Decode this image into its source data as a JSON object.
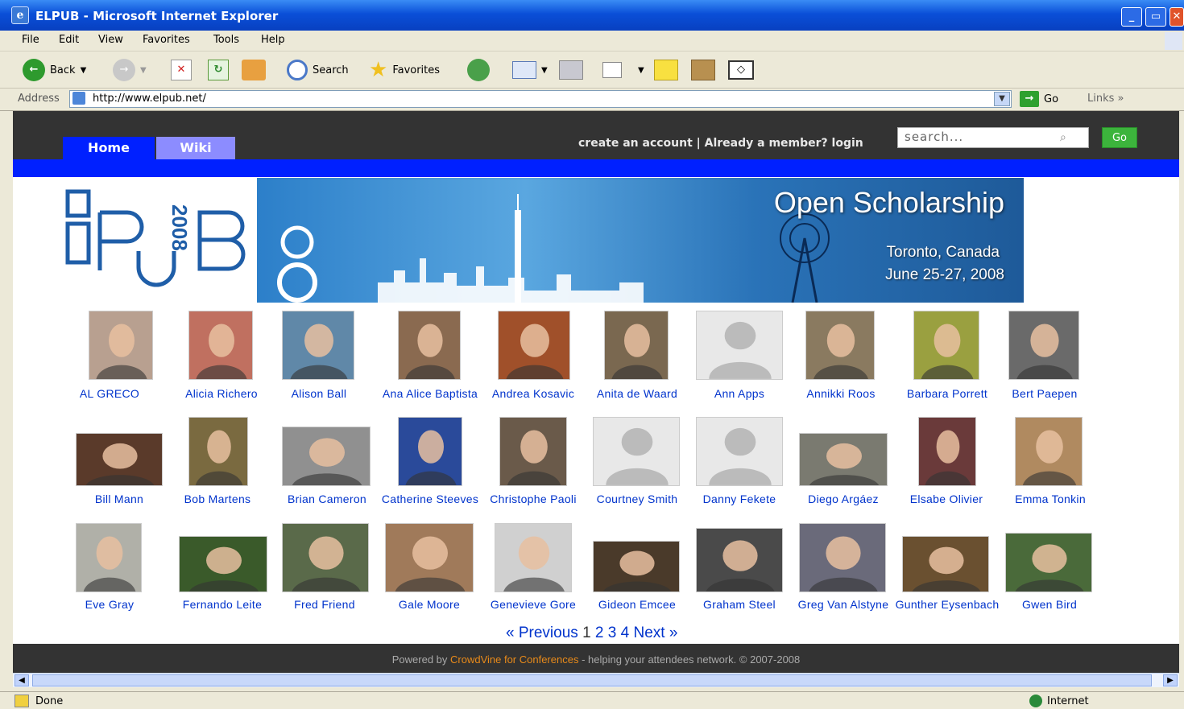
{
  "window": {
    "title": "ELPUB - Microsoft Internet Explorer"
  },
  "menu": [
    "File",
    "Edit",
    "View",
    "Favorites",
    "Tools",
    "Help"
  ],
  "toolbar": {
    "back": "Back",
    "search": "Search",
    "favorites": "Favorites"
  },
  "address": {
    "label": "Address",
    "url": "http://www.elpub.net/",
    "go": "Go",
    "links": "Links"
  },
  "site": {
    "tabs": [
      "Home",
      "Wiki"
    ],
    "account_links": "create an account | Already a member? login",
    "search_placeholder": "search...",
    "go": "Go",
    "logo_year": "2008",
    "banner": {
      "title": "Open Scholarship",
      "location": "Toronto, Canada",
      "dates": "June 25-27, 2008"
    },
    "people": [
      {
        "name": "AL GRECO",
        "color": "#b8a090"
      },
      {
        "name": "Alicia Richero",
        "color": "#c07060"
      },
      {
        "name": "Alison Ball",
        "color": "#6088a8"
      },
      {
        "name": "Ana Alice Baptista",
        "color": "#8a6a50"
      },
      {
        "name": "Andrea Kosavic",
        "color": "#a0502a"
      },
      {
        "name": "Anita de Waard",
        "color": "#7a6850"
      },
      {
        "name": "Ann Apps",
        "color": "#e8e8e8"
      },
      {
        "name": "Annikki Roos",
        "color": "#8a7a60"
      },
      {
        "name": "Barbara Porrett",
        "color": "#9aa040"
      },
      {
        "name": "Bert Paepen",
        "color": "#6a6a6a"
      },
      {
        "name": "Bill Mann",
        "color": "#5a3a2a"
      },
      {
        "name": "Bob Martens",
        "color": "#7a6a40"
      },
      {
        "name": "Brian Cameron",
        "color": "#909090"
      },
      {
        "name": "Catherine Steeves",
        "color": "#2a4a9a"
      },
      {
        "name": "Christophe Paoli",
        "color": "#6a5a4a"
      },
      {
        "name": "Courtney Smith",
        "color": "#e8e8e8"
      },
      {
        "name": "Danny Fekete",
        "color": "#e8e8e8"
      },
      {
        "name": "Diego Argáez",
        "color": "#7a7a70"
      },
      {
        "name": "Elsabe Olivier",
        "color": "#6a3a3a"
      },
      {
        "name": "Emma Tonkin",
        "color": "#b08a60"
      },
      {
        "name": "Eve Gray",
        "color": "#b0b0a8"
      },
      {
        "name": "Fernando Leite",
        "color": "#3a5a2a"
      },
      {
        "name": "Fred Friend",
        "color": "#5a6a4a"
      },
      {
        "name": "Gale Moore",
        "color": "#a07a5a"
      },
      {
        "name": "Genevieve Gore",
        "color": "#d0d0d0"
      },
      {
        "name": "Gideon Emcee",
        "color": "#4a3a2a"
      },
      {
        "name": "Graham Steel",
        "color": "#4a4a4a"
      },
      {
        "name": "Greg Van Alstyne",
        "color": "#6a6a7a"
      },
      {
        "name": "Gunther Eysenbach",
        "color": "#6a5030"
      },
      {
        "name": "Gwen Bird",
        "color": "#4a6a3a"
      }
    ],
    "pager": {
      "prev": "« Previous",
      "current": "1",
      "pages": [
        "2",
        "3",
        "4"
      ],
      "next": "Next »"
    },
    "footer": {
      "pre": "Powered by ",
      "link": "CrowdVine for Conferences",
      "post": " - helping your attendees network. © 2007-2008"
    }
  },
  "statusbar": {
    "status": "Done",
    "zone": "Internet"
  }
}
